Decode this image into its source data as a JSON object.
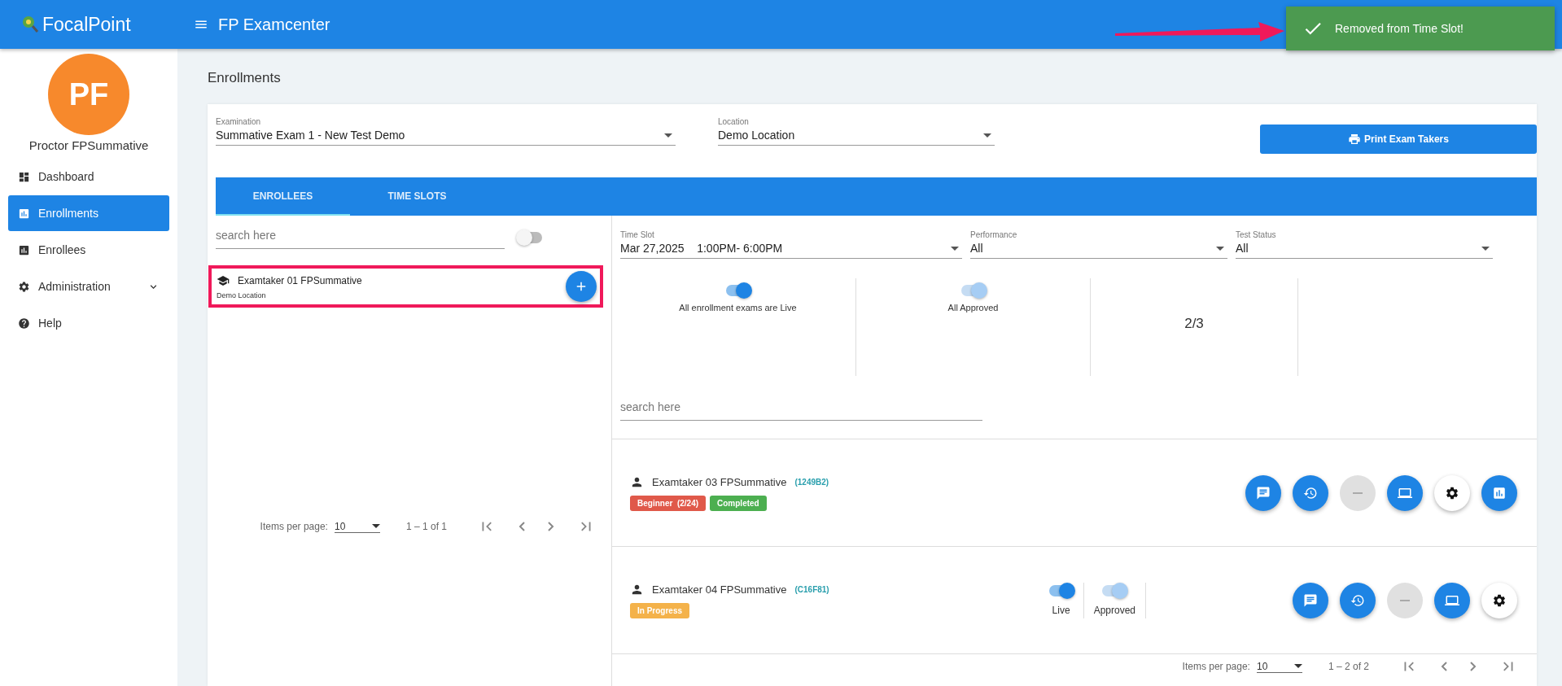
{
  "header": {
    "logo": "FocalPoint",
    "title": "FP Examcenter"
  },
  "toast": {
    "message": "Removed from Time Slot!"
  },
  "sidebar": {
    "avatar_initials": "PF",
    "user": "Proctor FPSummative",
    "items": [
      {
        "label": "Dashboard",
        "selected": false,
        "kind": "link"
      },
      {
        "label": "Enrollments",
        "selected": true,
        "kind": "link"
      },
      {
        "label": "Enrollees",
        "selected": false,
        "kind": "link"
      },
      {
        "label": "Administration",
        "selected": false,
        "kind": "group"
      },
      {
        "label": "Help",
        "selected": false,
        "kind": "link"
      }
    ]
  },
  "page_title": "Enrollments",
  "examination": {
    "label": "Examination",
    "value": "Summative Exam 1 - New Test Demo"
  },
  "location": {
    "label": "Location",
    "value": "Demo Location"
  },
  "print_button": "Print Exam Takers",
  "tabs": [
    {
      "label": "ENROLLEES",
      "selected": true
    },
    {
      "label": "TIME SLOTS",
      "selected": false
    }
  ],
  "left": {
    "search": {
      "placeholder": "search here"
    },
    "toggle": {
      "on": false
    },
    "items": [
      {
        "name": "Examtaker 01 FPSummative",
        "location": "Demo Location",
        "highlighted": true
      }
    ],
    "pagination": {
      "label": "Items per page:",
      "value": "10",
      "range": "1 – 1 of 1"
    }
  },
  "right": {
    "filters": [
      {
        "label": "Time Slot",
        "value": "Mar 27,2025    1:00PM- 6:00PM"
      },
      {
        "label": "Performance",
        "value": "All"
      },
      {
        "label": "Test Status",
        "value": "All"
      }
    ],
    "stats": [
      {
        "kind": "toggle",
        "on": true,
        "disabled": false,
        "label": "All enrollment exams are Live"
      },
      {
        "kind": "toggle",
        "on": true,
        "disabled": true,
        "label": "All Approved"
      },
      {
        "kind": "count",
        "value": "2/3"
      },
      {
        "kind": "empty"
      }
    ],
    "search": {
      "placeholder": "search here"
    },
    "enrollees": [
      {
        "name": "Examtaker 03 FPSummative",
        "code": "(1249B2)",
        "badges": [
          {
            "text": "Beginner  (2/24)",
            "color": "#e0594a"
          },
          {
            "text": "Completed",
            "color": "#4caf50"
          }
        ],
        "actions": [
          {
            "kind": "chat"
          },
          {
            "kind": "restore"
          },
          {
            "kind": "remove"
          },
          {
            "kind": "laptop"
          },
          {
            "kind": "settings"
          },
          {
            "kind": "report"
          }
        ]
      },
      {
        "name": "Examtaker 04 FPSummative",
        "code": "(C16F81)",
        "badges": [
          {
            "text": "In Progress",
            "color": "#f4b24a"
          }
        ],
        "switches": [
          {
            "label": "Live",
            "on": true,
            "disabled": false
          },
          {
            "label": "Approved",
            "on": true,
            "disabled": true
          }
        ],
        "actions": [
          {
            "kind": "chat"
          },
          {
            "kind": "restore"
          },
          {
            "kind": "remove"
          },
          {
            "kind": "laptop"
          },
          {
            "kind": "settings"
          }
        ]
      }
    ],
    "pagination": {
      "label": "Items per page:",
      "value": "10",
      "range": "1 – 2 of 2"
    }
  }
}
